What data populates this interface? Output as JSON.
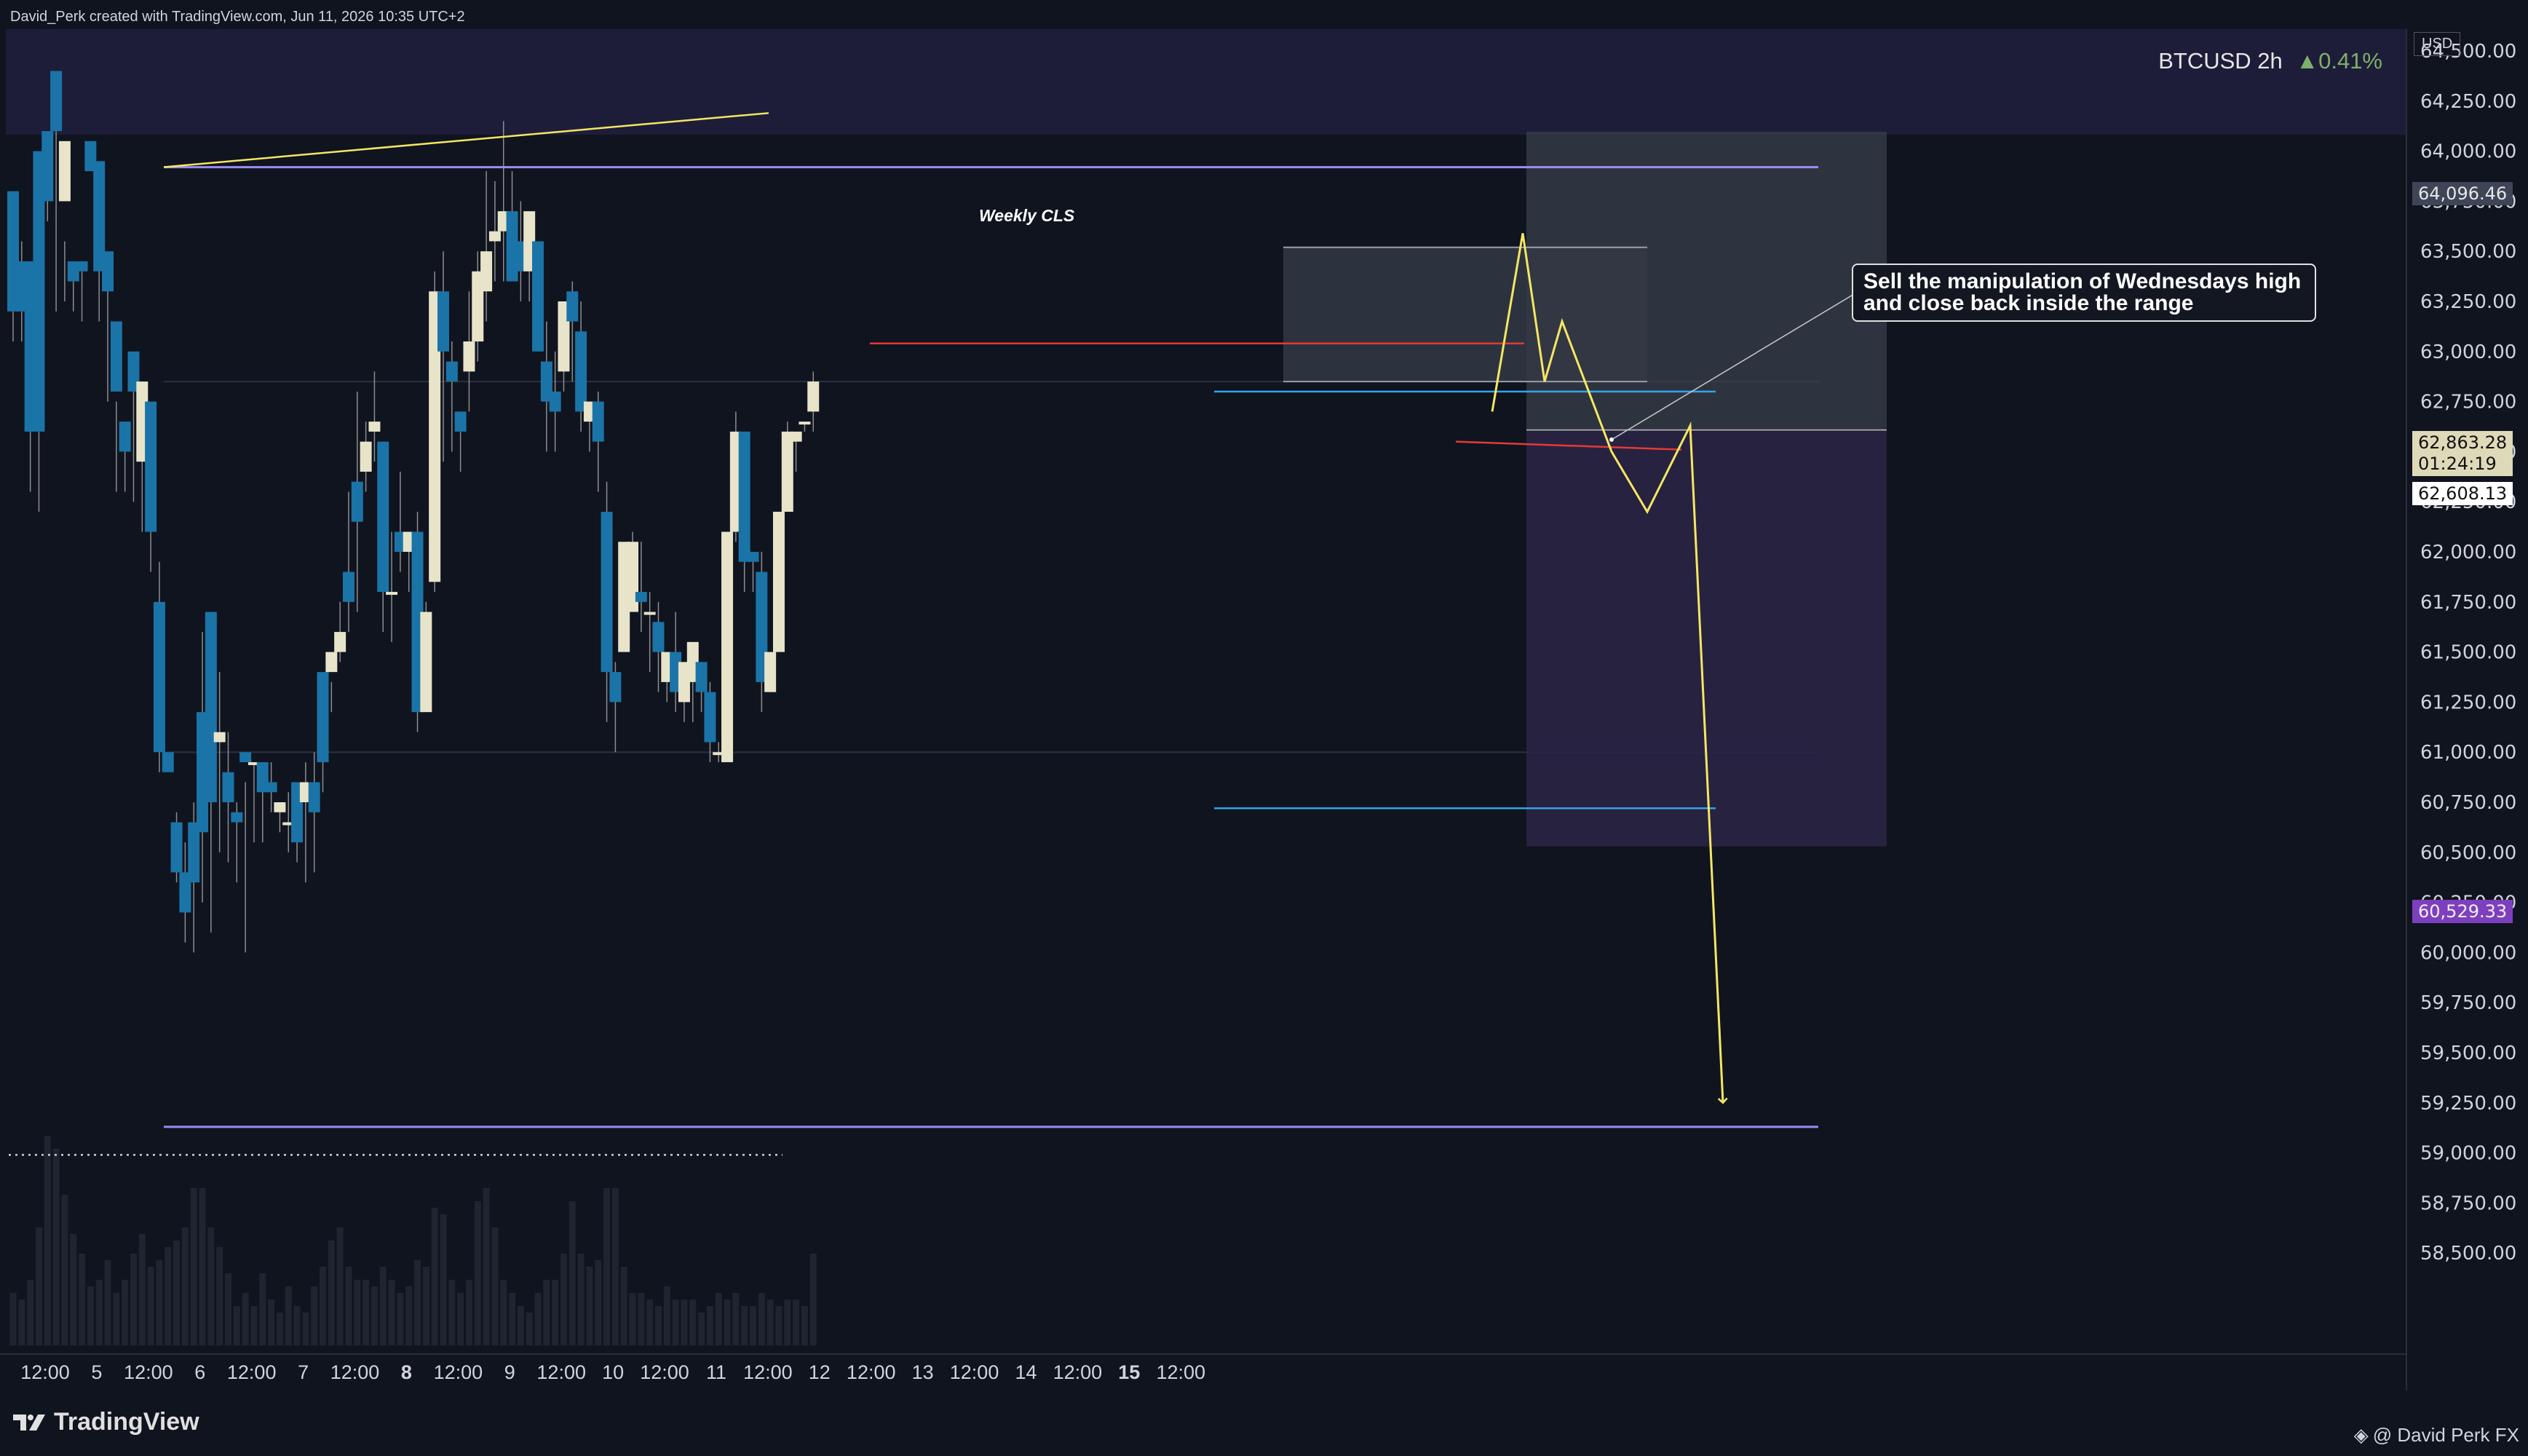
{
  "header": {
    "credit": "David_Perk created with TradingView.com, Jun 11, 2026 10:35 UTC+2"
  },
  "symbol": {
    "ticker": "BTCUSD 2h",
    "change_arrow": "▲",
    "change": "0.41%"
  },
  "price_axis": {
    "currency": "USD",
    "tag_top": "64,096.46",
    "tag_current_price": "62,863.28",
    "tag_current_timer": "01:24:19",
    "tag_entry": "62,608.13",
    "tag_target": "60,529.33"
  },
  "annotations": {
    "weekly_label": "Weekly CLS",
    "note_line1": "Sell the manipulation of Wednesdays high",
    "note_line2": "and close back inside the range"
  },
  "footer": {
    "brand": "TradingView",
    "author": "@ David Perk FX"
  },
  "colors": {
    "background": "#0f141f",
    "bull_candle": "#e8e4c9",
    "bear_candle": "#1a74a8",
    "zone": "#2a2450",
    "weekly_line": "#9b8cf2",
    "projection": "#f5e663",
    "red_level": "#e53935",
    "blue_level": "#36a3e6"
  },
  "chart_data": {
    "type": "candlestick",
    "symbol": "BTCUSD",
    "timeframe": "2h",
    "ylim": [
      58350,
      64850
    ],
    "y_ticks": [
      64500,
      64250,
      64000,
      63750,
      63500,
      63250,
      63000,
      62750,
      62500,
      62250,
      62000,
      61750,
      61500,
      61250,
      61000,
      60750,
      60500,
      60250,
      60000,
      59750,
      59500,
      59250,
      59000,
      58750,
      58500
    ],
    "y_tick_labels": [
      "64,500.00",
      "64,250.00",
      "64,000.00",
      "63,750.00",
      "63,500.00",
      "63,250.00",
      "63,000.00",
      "62,750.00",
      "62,500.00",
      "62,250.00",
      "62,000.00",
      "61,750.00",
      "61,500.00",
      "61,250.00",
      "61,000.00",
      "60,750.00",
      "60,500.00",
      "60,250.00",
      "60,000.00",
      "59,750.00",
      "59,500.00",
      "59,250.00",
      "59,000.00",
      "58,750.00",
      "58,500.00"
    ],
    "x_labels": [
      "12:00",
      "5",
      "12:00",
      "6",
      "12:00",
      "7",
      "12:00",
      "8",
      "12:00",
      "9",
      "12:00",
      "10",
      "12:00",
      "11",
      "12:00",
      "12",
      "12:00",
      "13",
      "12:00",
      "14",
      "12:00",
      "15",
      "12:00"
    ],
    "x_bold": [
      "8",
      "15"
    ],
    "candles": [
      [
        63550,
        63800,
        63200,
        63050
      ],
      [
        63550,
        63450,
        63200,
        63050
      ],
      [
        63400,
        63450,
        62600,
        62300
      ],
      [
        62600,
        64000,
        62600,
        62200
      ],
      [
        64000,
        64100,
        63750,
        63650
      ],
      [
        64100,
        64400,
        64100,
        63200
      ],
      [
        63550,
        63750,
        64050,
        63250
      ],
      [
        63400,
        63450,
        63350,
        63200
      ],
      [
        63450,
        63450,
        63400,
        63150
      ],
      [
        63300,
        64050,
        63900,
        63300
      ],
      [
        63600,
        63950,
        63400,
        63150
      ],
      [
        63400,
        63500,
        63300,
        62750
      ],
      [
        62750,
        63150,
        62800,
        62300
      ],
      [
        62500,
        62650,
        62500,
        62300
      ],
      [
        62900,
        63000,
        62800,
        62250
      ],
      [
        62450,
        62450,
        62850,
        62100
      ],
      [
        62500,
        62750,
        62100,
        61900
      ],
      [
        61950,
        61750,
        61000,
        60900
      ],
      [
        60400,
        61000,
        60900,
        60400
      ],
      [
        60700,
        60650,
        60400,
        60350
      ],
      [
        60550,
        60400,
        60200,
        60050
      ],
      [
        60750,
        60650,
        60350,
        60000
      ],
      [
        61600,
        61200,
        60600,
        60250
      ],
      [
        61300,
        61700,
        60750,
        60100
      ],
      [
        61400,
        61050,
        61100,
        60500
      ],
      [
        61100,
        60900,
        60750,
        60450
      ],
      [
        60750,
        60700,
        60650,
        60350
      ],
      [
        60850,
        61000,
        60950,
        60000
      ],
      [
        60950,
        60950,
        60950,
        60550
      ],
      [
        60850,
        60950,
        60800,
        60550
      ],
      [
        60950,
        60850,
        60800,
        60700
      ],
      [
        60750,
        60700,
        60750,
        60600
      ],
      [
        60800,
        60650,
        60650,
        60500
      ],
      [
        60750,
        60850,
        60550,
        60450
      ],
      [
        60950,
        60750,
        60850,
        60350
      ],
      [
        61000,
        60850,
        60700,
        60400
      ],
      [
        61000,
        61400,
        60950,
        60800
      ],
      [
        61350,
        61400,
        61500,
        61200
      ],
      [
        61750,
        61500,
        61600,
        61450
      ],
      [
        62300,
        61900,
        61750,
        61600
      ],
      [
        62800,
        62350,
        62150,
        61700
      ],
      [
        62650,
        62400,
        62550,
        62300
      ],
      [
        62900,
        62600,
        62650,
        62450
      ],
      [
        62550,
        62550,
        61800,
        61600
      ],
      [
        62100,
        61800,
        61800,
        61550
      ],
      [
        62400,
        62100,
        62000,
        61900
      ],
      [
        62100,
        62000,
        62100,
        61800
      ],
      [
        62200,
        62100,
        61200,
        61100
      ],
      [
        61750,
        61200,
        61700,
        61200
      ],
      [
        63400,
        61850,
        63300,
        61800
      ],
      [
        63500,
        63300,
        63000,
        62450
      ],
      [
        63050,
        62950,
        62850,
        62500
      ],
      [
        62700,
        62700,
        62600,
        62400
      ],
      [
        63300,
        62900,
        63050,
        62700
      ],
      [
        63500,
        63050,
        63400,
        62950
      ],
      [
        63900,
        63300,
        63500,
        63150
      ],
      [
        63850,
        63550,
        63600,
        63350
      ],
      [
        64150,
        63600,
        63700,
        63350
      ],
      [
        63900,
        63700,
        63350,
        63350
      ],
      [
        63750,
        63550,
        63400,
        63250
      ],
      [
        63600,
        63400,
        63700,
        63250
      ],
      [
        63550,
        63550,
        63000,
        63000
      ],
      [
        63150,
        62950,
        62750,
        62500
      ],
      [
        63000,
        62800,
        62700,
        62500
      ],
      [
        63000,
        62900,
        63250,
        62800
      ],
      [
        63350,
        63300,
        63150,
        62850
      ],
      [
        63250,
        63100,
        62700,
        62600
      ],
      [
        62750,
        62650,
        62750,
        62500
      ],
      [
        62800,
        62750,
        62550,
        62300
      ],
      [
        62350,
        62200,
        61400,
        61150
      ],
      [
        61450,
        61400,
        61250,
        61000
      ],
      [
        61700,
        61500,
        62050,
        61550
      ],
      [
        62100,
        61700,
        62050,
        61750
      ],
      [
        62050,
        61800,
        61750,
        61600
      ],
      [
        61800,
        61700,
        61700,
        61400
      ],
      [
        61750,
        61650,
        61500,
        61300
      ],
      [
        61450,
        61350,
        61500,
        61250
      ],
      [
        61700,
        61500,
        61300,
        61200
      ],
      [
        61350,
        61250,
        61450,
        61150
      ],
      [
        61450,
        61350,
        61550,
        61150
      ],
      [
        61350,
        61450,
        61300,
        61200
      ],
      [
        61350,
        61300,
        61050,
        60950
      ],
      [
        61050,
        61000,
        61000,
        60950
      ],
      [
        60900,
        60950,
        62100,
        60900
      ],
      [
        62700,
        62100,
        62600,
        62050
      ],
      [
        62600,
        62600,
        61950,
        61800
      ],
      [
        62000,
        62000,
        61950,
        61800
      ],
      [
        62000,
        61900,
        61350,
        61200
      ],
      [
        61350,
        61300,
        61500,
        61300
      ],
      [
        61650,
        61500,
        62200,
        61600
      ],
      [
        62650,
        62200,
        62600,
        62200
      ],
      [
        62600,
        62550,
        62600,
        62400
      ],
      [
        62650,
        62650,
        62650,
        62600
      ],
      [
        62900,
        62700,
        62850,
        62600
      ]
    ],
    "volumes": [
      0.08,
      0.07,
      0.1,
      0.18,
      0.32,
      0.3,
      0.23,
      0.17,
      0.14,
      0.09,
      0.1,
      0.13,
      0.08,
      0.1,
      0.14,
      0.17,
      0.12,
      0.13,
      0.15,
      0.16,
      0.18,
      0.24,
      0.24,
      0.18,
      0.15,
      0.11,
      0.06,
      0.08,
      0.06,
      0.11,
      0.07,
      0.05,
      0.09,
      0.06,
      0.05,
      0.09,
      0.12,
      0.16,
      0.18,
      0.12,
      0.1,
      0.1,
      0.09,
      0.12,
      0.1,
      0.08,
      0.09,
      0.13,
      0.12,
      0.21,
      0.2,
      0.1,
      0.08,
      0.1,
      0.22,
      0.24,
      0.18,
      0.1,
      0.08,
      0.06,
      0.05,
      0.08,
      0.1,
      0.1,
      0.14,
      0.22,
      0.14,
      0.12,
      0.13,
      0.24,
      0.24,
      0.12,
      0.08,
      0.08,
      0.07,
      0.06,
      0.09,
      0.07,
      0.07,
      0.07,
      0.05,
      0.06,
      0.08,
      0.07,
      0.08,
      0.06,
      0.06,
      0.08,
      0.07,
      0.06,
      0.07,
      0.07,
      0.06,
      0.14
    ],
    "levels": {
      "weekly_cls": 63920,
      "weekly_low": 59130,
      "session_high": 62800,
      "session_low": 60720,
      "red_top": 63040,
      "red_bottom": 62550,
      "swing_ray_start": 63920,
      "swing_ray_end": 64190
    },
    "short_position": {
      "entry": 62608.13,
      "stop": 64096.46,
      "target": 60529.33
    },
    "projection_path": [
      62700,
      63590,
      62850,
      63150,
      62500,
      62200,
      62630,
      59250
    ]
  }
}
